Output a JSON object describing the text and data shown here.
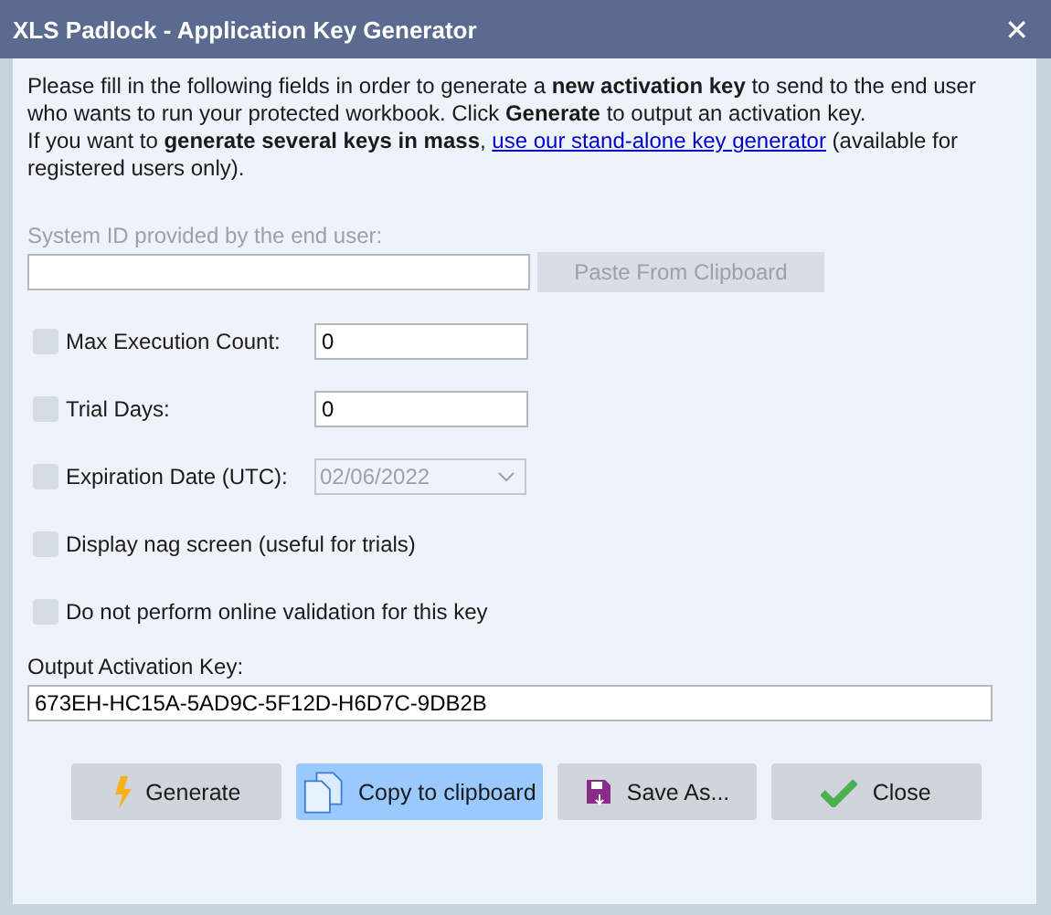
{
  "window": {
    "title": "XLS Padlock - Application Key Generator",
    "close": "✕"
  },
  "intro": {
    "before": "Please fill in the following fields in order to generate a **new activation key** to send to the end user who wants to run your protected workbook. Click **Generate** to output an activation key.\nIf you want to **generate several keys in mass**, ",
    "link": "use our stand-alone key generator",
    "after": " (available for registered users only)."
  },
  "system_id": {
    "label": "System ID provided by the end user:",
    "paste_button": {
      "label": "Paste From Clipboard",
      "disabled": true
    }
  },
  "options": [
    {
      "kind": "number",
      "label": "Max Execution Count:",
      "checked": false,
      "value": "0"
    },
    {
      "kind": "number",
      "label": "Trial Days:",
      "checked": false,
      "value": "0"
    },
    {
      "kind": "date",
      "label": "Expiration Date (UTC):",
      "checked": false,
      "value": "02/06/2022"
    },
    {
      "kind": "plain",
      "label": "Display nag screen (useful for trials)",
      "checked": false
    },
    {
      "kind": "plain",
      "label": "Do not perform online validation for this key",
      "checked": false
    }
  ],
  "output": {
    "label": "Output Activation Key:",
    "value": "673EH-HC15A-5AD9C-5F12D-H6D7C-9DB2B"
  },
  "buttons": [
    {
      "kind": "generate",
      "label": "Generate",
      "highlighted": false
    },
    {
      "kind": "copy",
      "label": "Copy to clipboard",
      "highlighted": true
    },
    {
      "kind": "save",
      "label": "Save As...",
      "highlighted": false
    },
    {
      "kind": "close",
      "label": "Close",
      "highlighted": false
    }
  ]
}
